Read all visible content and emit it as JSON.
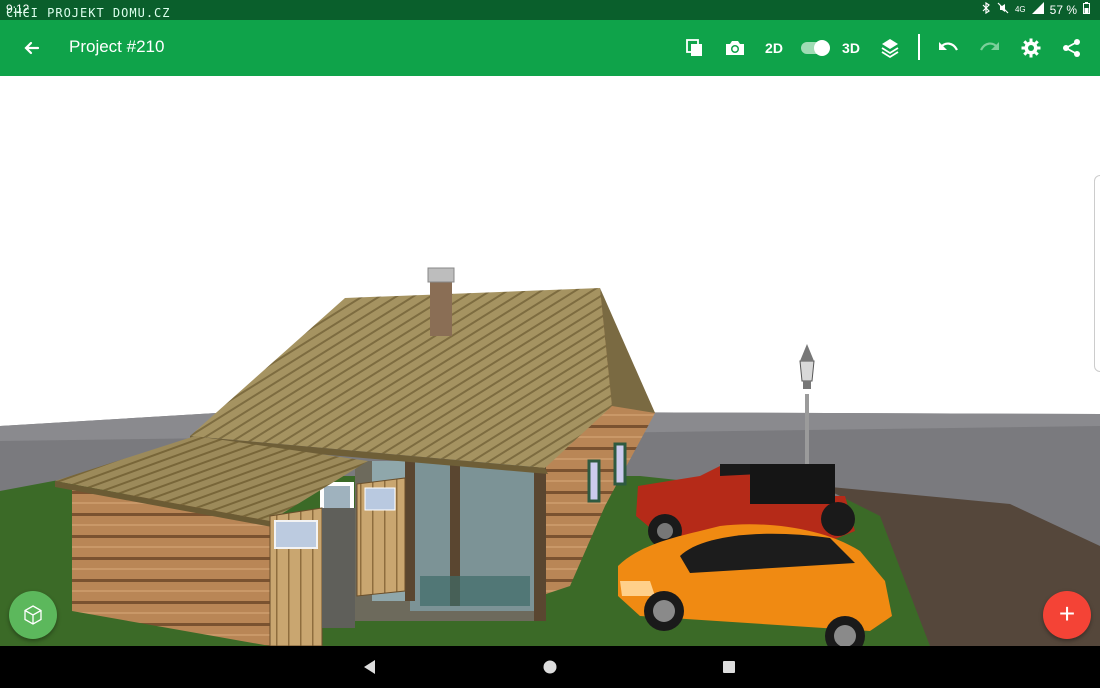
{
  "status_bar": {
    "time": "9:12",
    "watermark": "CHCI PROJEKT DOMU.CZ",
    "network": "4G",
    "battery": "57 %"
  },
  "toolbar": {
    "title": "Project #210",
    "mode_2d_label": "2D",
    "mode_3d_label": "3D",
    "toggle_on": true
  },
  "fab": {
    "add_label": "+"
  },
  "colors": {
    "toolbar": "#0fa34a",
    "status_bar": "#0a5f2c",
    "fab_add": "#f44336",
    "fab_view": "#5cb85c"
  },
  "icons": [
    "back-arrow-icon",
    "copy-icon",
    "camera-icon",
    "layers-icon",
    "undo-icon",
    "redo-icon",
    "settings-icon",
    "share-icon",
    "cube-icon",
    "add-icon",
    "nav-back-icon",
    "nav-home-icon",
    "nav-recents-icon"
  ]
}
